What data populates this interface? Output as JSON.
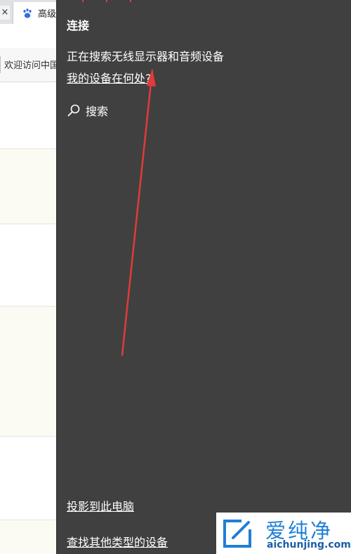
{
  "browser": {
    "tab_close": "×",
    "tab_title": "高级",
    "bookmark": "欢迎访问中国"
  },
  "connect_panel": {
    "title": "连接",
    "status": "正在搜索无线显示器和音频设备",
    "where_link": "我的设备在何处?",
    "search_label": "搜索",
    "project_link": "投影到此电脑",
    "find_link": "查找其他类型的设备"
  },
  "watermark": {
    "brand_cn": "爱纯净",
    "brand_en": "aichunjing.com"
  },
  "colors": {
    "panel_bg": "#404040",
    "arrow": "#e23a3a",
    "brand_blue": "#1f7fd6"
  },
  "icons": [
    "paw-favicon-icon",
    "search-icon",
    "brand-logo-icon"
  ]
}
